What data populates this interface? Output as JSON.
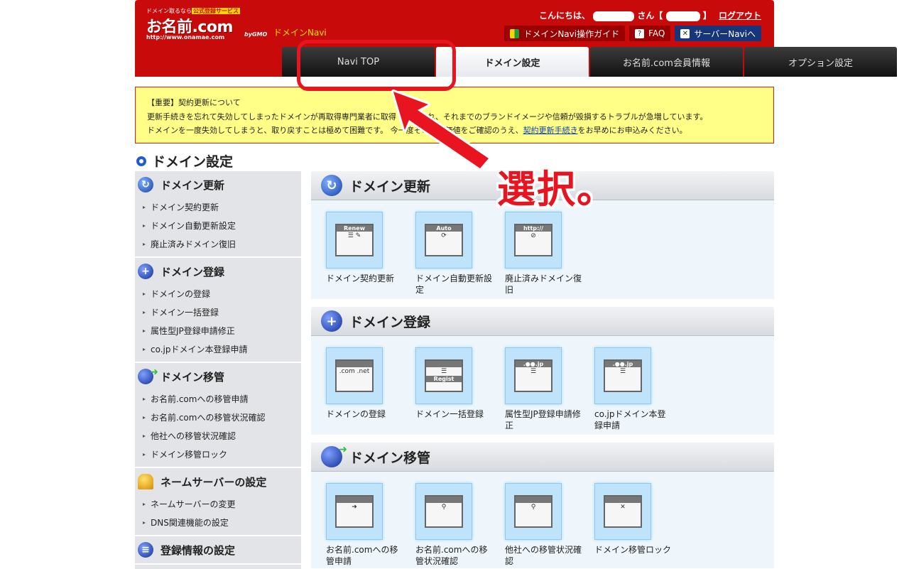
{
  "header": {
    "logo_tag": "ドメイン取るなら",
    "logo_tag_badge": "公式登録サービス",
    "logo_main": "お名前.com",
    "logo_url": "http://www.onamae.com",
    "logo_gmo": "byGMO",
    "sub": "ドメインNavi",
    "greeting_prefix": "こんにちは、",
    "greeting_mid": "さん【",
    "greeting_suffix": "】",
    "logout": "ログアウト",
    "links": {
      "guide": "ドメインNavi操作ガイド",
      "faq": "FAQ",
      "server": "サーバーNaviへ"
    }
  },
  "tabs": [
    "Navi TOP",
    "ドメイン設定",
    "お名前.com会員情報",
    "オプション設定"
  ],
  "notice": {
    "title": "【重要】契約更新について",
    "line1": "更新手続きを忘れて失効してしまったドメインが再取得専門業者に取得・悪用され、それまでのブランドイメージや信頼が毀損するトラブルが急増しています。",
    "line2_pre": "ドメインを一度失効してしまうと、取り戻すことは極めて困難です。 今一度その財産価値をご確認のうえ、",
    "line2_link": "契約更新手続き",
    "line2_post": "をお早めにお申込みください。"
  },
  "page_title": "ドメイン設定",
  "sidebar": {
    "sections": [
      {
        "title": "ドメイン更新",
        "icon": "renew-icon",
        "items": [
          "ドメイン契約更新",
          "ドメイン自動更新設定",
          "廃止済みドメイン復旧"
        ]
      },
      {
        "title": "ドメイン登録",
        "icon": "plus-icon",
        "items": [
          "ドメインの登録",
          "ドメイン一括登録",
          "属性型JP登録申請修正",
          "co.jpドメイン本登録申請"
        ]
      },
      {
        "title": "ドメイン移管",
        "icon": "transfer-icon",
        "items": [
          "お名前.comへの移管申請",
          "お名前.comへの移管状況確認",
          "他社への移管状況確認",
          "ドメイン移管ロック"
        ]
      },
      {
        "title": "ネームサーバーの設定",
        "icon": "nameserver-icon",
        "items": [
          "ネームサーバーの変更",
          "DNS関連機能の設定"
        ]
      },
      {
        "title": "登録情報の設定",
        "icon": "registration-info-icon",
        "items": []
      }
    ]
  },
  "panels": [
    {
      "title": "ドメイン更新",
      "icon": "renew-icon",
      "tiles": [
        {
          "label": "ドメイン契約更新",
          "art": "Renew"
        },
        {
          "label": "ドメイン自動更新設定",
          "art": "Auto"
        },
        {
          "label": "廃止済みドメイン復旧",
          "art": "http://"
        }
      ]
    },
    {
      "title": "ドメイン登録",
      "icon": "plus-icon",
      "tiles": [
        {
          "label": "ドメインの登録",
          "art": ".com .net"
        },
        {
          "label": "ドメイン一括登録",
          "art": "Regist"
        },
        {
          "label": "属性型JP登録申請修正",
          "art": ".●●.jp"
        },
        {
          "label": "co.jpドメイン本登録申請",
          "art": ".●●.jp"
        }
      ]
    },
    {
      "title": "ドメイン移管",
      "icon": "transfer-icon",
      "tiles": [
        {
          "label": "お名前.comへの移管申請",
          "art": ""
        },
        {
          "label": "お名前.comへの移管状況確認",
          "art": ""
        },
        {
          "label": "他社への移管状況確認",
          "art": ""
        },
        {
          "label": "ドメイン移管ロック",
          "art": "✕"
        }
      ]
    }
  ],
  "annotation": {
    "text": "選択。",
    "color": "#e8141f"
  },
  "colors": {
    "header": "#c80a0a",
    "notice_bg": "#ffff88",
    "accent_blue": "#1f5bd6"
  }
}
